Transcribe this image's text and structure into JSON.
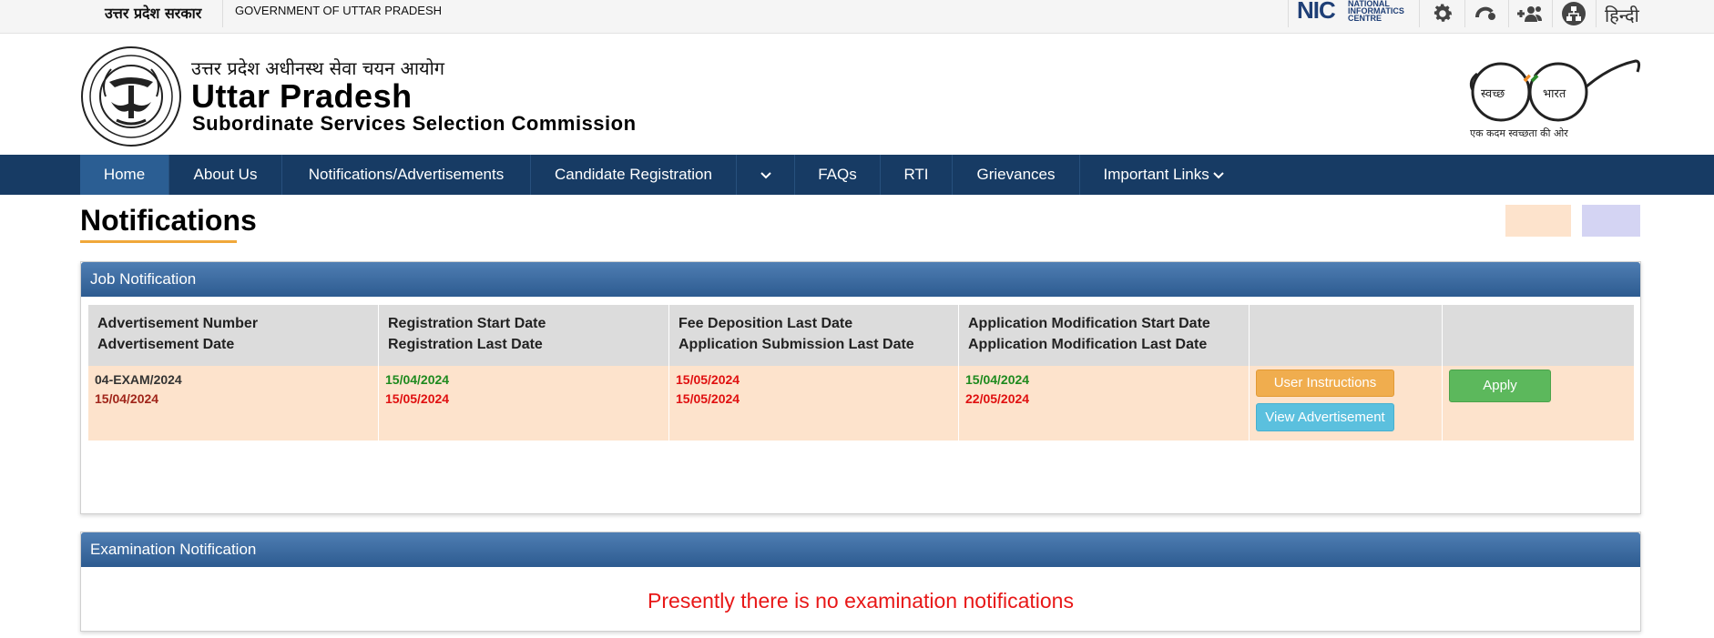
{
  "topbar": {
    "gov_hindi": "उत्तर प्रदेश सरकार",
    "gov_english": "GOVERNMENT OF UTTAR PRADESH",
    "nic_mark": "NIC",
    "nic_lines": [
      "NATIONAL",
      "INFORMATICS",
      "CENTRE"
    ],
    "language_link": "हिन्दी"
  },
  "header": {
    "title_hindi": "उत्तर प्रदेश अधीनस्थ सेवा चयन आयोग",
    "title_main": "Uttar Pradesh",
    "title_sub": "Subordinate Services Selection Commission",
    "swachh_left": "स्वच्छ",
    "swachh_right": "भारत",
    "swachh_tagline": "एक कदम स्वच्छता की ओर"
  },
  "nav": {
    "items": [
      "Home",
      "About Us",
      "Notifications/Advertisements",
      "Candidate Registration",
      "FAQs",
      "RTI",
      "Grievances",
      "Important Links"
    ]
  },
  "page": {
    "title": "Notifications"
  },
  "job_panel": {
    "heading": "Job Notification",
    "columns": [
      [
        "Advertisement Number",
        "Advertisement Date"
      ],
      [
        "Registration Start Date",
        "Registration Last Date"
      ],
      [
        "Fee Deposition Last Date",
        "Application Submission Last Date"
      ],
      [
        "Application Modification Start Date",
        "Application Modification Last Date"
      ]
    ],
    "row": {
      "adv_number": "04-EXAM/2024",
      "adv_date": "15/04/2024",
      "reg_start": "15/04/2024",
      "reg_last": "15/05/2024",
      "fee_last": "15/05/2024",
      "submission_last": "15/05/2024",
      "mod_start": "15/04/2024",
      "mod_last": "22/05/2024",
      "btn_instructions": "User Instructions",
      "btn_view": "View Advertisement",
      "btn_apply": "Apply"
    }
  },
  "exam_panel": {
    "heading": "Examination Notification",
    "message": "Presently there is no examination notifications"
  },
  "colors": {
    "nav_bg": "#173b64",
    "panel_head": "#2d5b90",
    "row_peach": "#fde3cc",
    "accent_orange": "#f0a83a",
    "alert_red": "#e81717"
  }
}
